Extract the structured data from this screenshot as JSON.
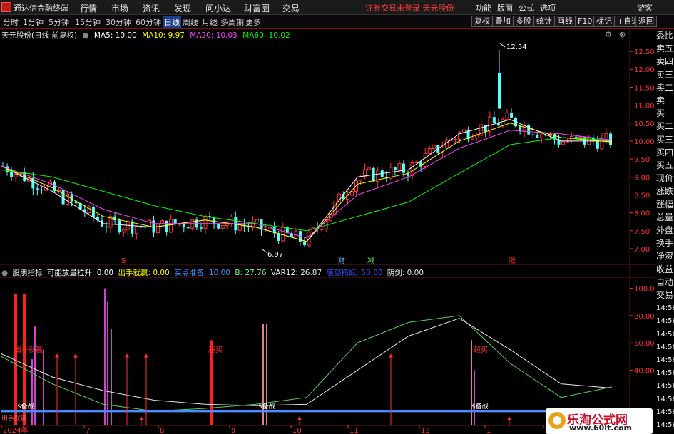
{
  "titlebar": {
    "app_title": "通达信金融终端",
    "menus": [
      "行情",
      "市场",
      "资讯",
      "发现",
      "问小达",
      "财富圈",
      "交易"
    ],
    "login_status": "证券交易未登录  天元股份",
    "right_menus": [
      "功能",
      "版面",
      "公式",
      "选项"
    ],
    "guest": "游客"
  },
  "toolbar": {
    "periods": [
      "分时",
      "1分钟",
      "5分钟",
      "15分钟",
      "30分钟",
      "60分钟",
      "日线",
      "周线",
      "月线",
      "多周期",
      "更多"
    ],
    "active_period": "日线",
    "right_buttons": [
      "复权",
      "叠加",
      "多股",
      "统计",
      "画线",
      "F10",
      "标记",
      "+自选",
      "返回"
    ]
  },
  "main_legend": {
    "stock_name": "天元股份(日线 前复权)",
    "ma5": "MA5: 10.00",
    "ma10": "MA10: 9.97",
    "ma20": "MA20: 10.03",
    "ma60": "MA60: 10.02"
  },
  "price_axis": {
    "ticks": [
      "12.50",
      "12.00",
      "11.50",
      "11.00",
      "10.50",
      "10.00",
      "9.50",
      "9.00",
      "8.50",
      "8.00",
      "7.50",
      "7.00"
    ],
    "high_label": "12.54",
    "low_label": "6.97"
  },
  "event_marks": [
    "S",
    "财",
    "减",
    "涨"
  ],
  "indicator_legend": {
    "name": "股朋指标",
    "l1": "可能放量拉升: 0.00",
    "l2": "出手就赢: 0.00",
    "l3": "买点准备: 10.00",
    "l4": "B: 27.76",
    "l5": "VAR12: 26.87",
    "l6": "底部抓妖: 50.00",
    "l7": "阴剑: 0.00"
  },
  "indicator_axis": {
    "ticks": [
      "100.0",
      "80.00",
      "60.00",
      "40.00"
    ]
  },
  "indicator_labels": {
    "buy1": "出手就赢",
    "buy2": "出手就赢",
    "buy3": "超买",
    "buy4": "超买",
    "prep": "$备战",
    "bottom": "出手就赢"
  },
  "date_axis": {
    "labels": [
      "2024年",
      "7",
      "8",
      "9",
      "10",
      "11",
      "12",
      "1",
      "2"
    ]
  },
  "sidebar": {
    "items": [
      "委比",
      "卖五",
      "卖四",
      "卖三",
      "卖二",
      "卖一",
      "买一",
      "买二",
      "买三",
      "买四",
      "买五",
      "现价",
      "涨跌",
      "涨幅",
      "总量",
      "外盘",
      "换手",
      "净资",
      "收益",
      "自动",
      "交易",
      "14:56",
      "14:56",
      "14:56",
      "14:56",
      "14:56",
      "14:56",
      "14:56",
      "14:56",
      "14:56",
      "14:56"
    ]
  },
  "watermark": {
    "title": "乐淘公式网",
    "url": "www.60lt.com"
  },
  "colors": {
    "up": "#ff3232",
    "down": "#54ffff",
    "ma5": "#ffffff",
    "ma10": "#ffff00",
    "ma20": "#ff40ff",
    "ma60": "#00ff00"
  },
  "chart_data": [
    {
      "type": "line",
      "title": "天元股份(日线 前复权)",
      "ylim": [
        6.9,
        12.7
      ],
      "x": [
        "2024年",
        "7",
        "8",
        "9",
        "10",
        "11",
        "12",
        "1",
        "2"
      ],
      "series": [
        {
          "name": "MA5",
          "values": [
            9.3,
            8.6,
            7.7,
            7.6,
            7.8,
            7.6,
            7.2,
            9.0,
            9.2,
            10.2,
            10.6,
            10.0,
            10.0
          ]
        },
        {
          "name": "MA10",
          "values": [
            9.3,
            8.7,
            7.9,
            7.6,
            7.8,
            7.6,
            7.2,
            8.8,
            9.1,
            10.0,
            10.5,
            10.1,
            9.97
          ]
        },
        {
          "name": "MA20",
          "values": [
            9.3,
            8.8,
            8.1,
            7.7,
            7.7,
            7.7,
            7.3,
            8.5,
            9.0,
            9.8,
            10.3,
            10.2,
            10.03
          ]
        },
        {
          "name": "MA60",
          "values": [
            9.2,
            9.0,
            8.6,
            8.2,
            7.9,
            7.7,
            7.5,
            7.9,
            8.3,
            9.1,
            9.9,
            10.1,
            10.02
          ]
        }
      ],
      "annotations": [
        "12.54",
        "6.97"
      ]
    },
    {
      "type": "line",
      "title": "股朋指标",
      "ylim": [
        0,
        105
      ],
      "series": [
        {
          "name": "B",
          "values": [
            50,
            30,
            15,
            10,
            12,
            15,
            20,
            60,
            75,
            80,
            45,
            20,
            27.76
          ]
        },
        {
          "name": "VAR12",
          "values": [
            52,
            35,
            25,
            18,
            15,
            14,
            15,
            40,
            65,
            78,
            55,
            30,
            26.87
          ]
        },
        {
          "name": "买点准备",
          "values": [
            10,
            10,
            10,
            10,
            10,
            10,
            10,
            10,
            10,
            10,
            10,
            10,
            10
          ]
        }
      ]
    }
  ]
}
